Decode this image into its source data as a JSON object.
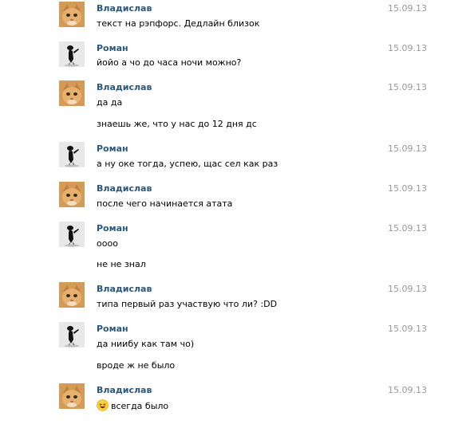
{
  "messages": [
    {
      "author": "Владислав",
      "avatar": "cat-avatar",
      "date": "15.09.13",
      "lines": [
        "текст на рэпфорс. Дедлайн близок"
      ]
    },
    {
      "author": "Роман",
      "avatar": "figure-avatar",
      "date": "15.09.13",
      "lines": [
        "йойо а чо до часа ночи можно?"
      ]
    },
    {
      "author": "Владислав",
      "avatar": "cat-avatar",
      "date": "15.09.13",
      "lines": [
        "да да",
        "знаешь же, что у нас до 12 дня дс"
      ]
    },
    {
      "author": "Роман",
      "avatar": "figure-avatar",
      "date": "15.09.13",
      "lines": [
        "а ну оке тогда, успею, щас сел как раз"
      ]
    },
    {
      "author": "Владислав",
      "avatar": "cat-avatar",
      "date": "15.09.13",
      "lines": [
        "после чего начинается атата"
      ]
    },
    {
      "author": "Роман",
      "avatar": "figure-avatar",
      "date": "15.09.13",
      "lines": [
        "оооо",
        "не не знал"
      ]
    },
    {
      "author": "Владислав",
      "avatar": "cat-avatar",
      "date": "15.09.13",
      "lines": [
        "типа первый раз участвую что ли? :DD"
      ]
    },
    {
      "author": "Роман",
      "avatar": "figure-avatar",
      "date": "15.09.13",
      "lines": [
        "да ниибу как там чо)",
        "вроде ж не было"
      ]
    },
    {
      "author": "Владислав",
      "avatar": "cat-avatar",
      "date": "15.09.13",
      "lines": [
        "всегда было"
      ],
      "emoji": "laughing-emoji-icon"
    }
  ],
  "colors": {
    "author": "#2b587a",
    "date": "#999999",
    "text": "#000000"
  }
}
